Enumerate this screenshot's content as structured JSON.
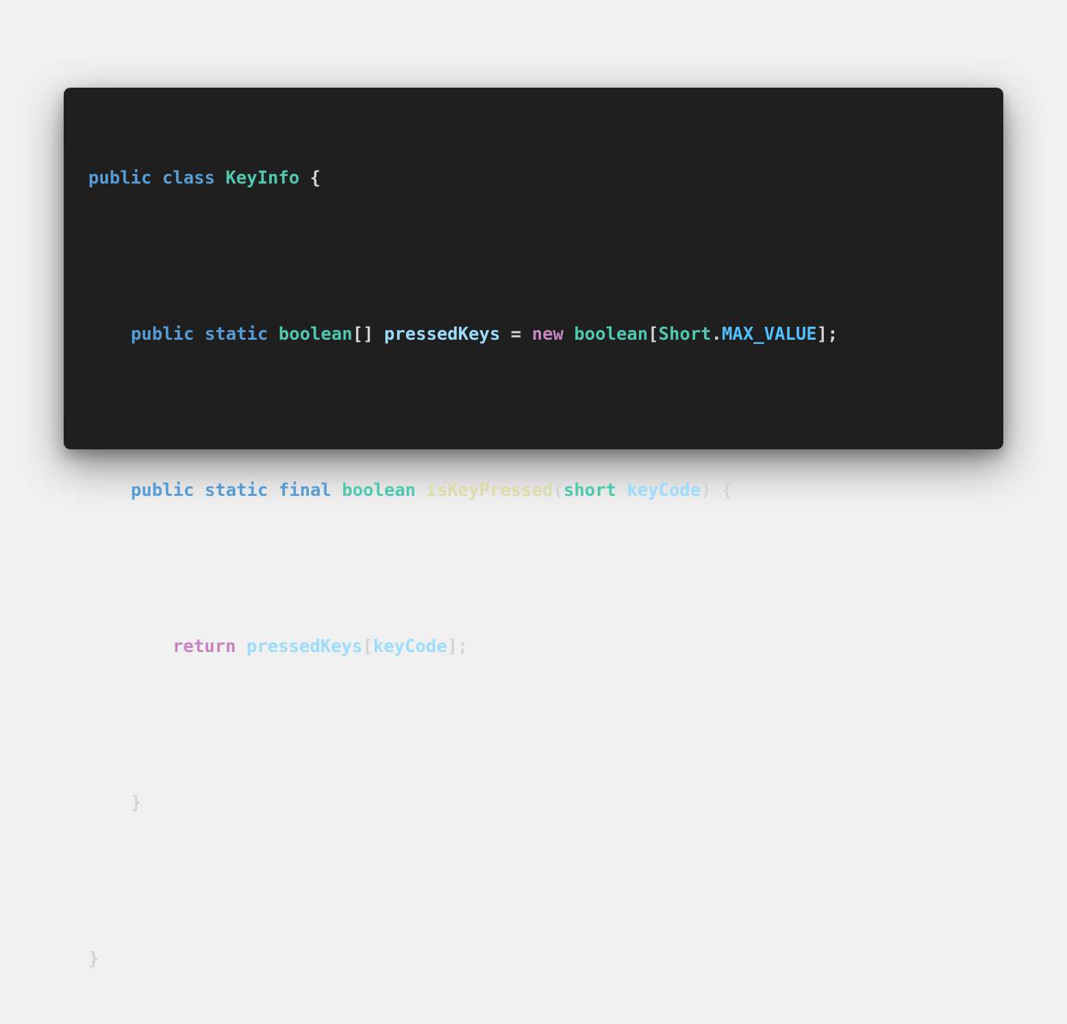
{
  "editor": {
    "language": "java",
    "theme": {
      "background": "#1f1f1f",
      "page_background": "#f0f0f0",
      "keyword": "#569cd6",
      "type": "#4ec9b0",
      "control": "#c586c0",
      "function": "#dcdcaa",
      "variable": "#9cdcfe",
      "constant": "#4fc1ff",
      "punctuation": "#d4d4d4"
    },
    "lines": [
      {
        "tokens": [
          {
            "text": "public",
            "kind": "kw"
          },
          {
            "text": " ",
            "kind": "punc"
          },
          {
            "text": "class",
            "kind": "kw"
          },
          {
            "text": " ",
            "kind": "punc"
          },
          {
            "text": "KeyInfo",
            "kind": "type"
          },
          {
            "text": " {",
            "kind": "punc"
          }
        ]
      },
      {
        "tokens": []
      },
      {
        "tokens": [
          {
            "text": "public",
            "kind": "kw"
          },
          {
            "text": " ",
            "kind": "punc"
          },
          {
            "text": "static",
            "kind": "kw"
          },
          {
            "text": " ",
            "kind": "punc"
          },
          {
            "text": "boolean",
            "kind": "type"
          },
          {
            "text": "[] ",
            "kind": "punc"
          },
          {
            "text": "pressedKeys",
            "kind": "var"
          },
          {
            "text": " = ",
            "kind": "punc"
          },
          {
            "text": "new",
            "kind": "ctrl"
          },
          {
            "text": " ",
            "kind": "punc"
          },
          {
            "text": "boolean",
            "kind": "type"
          },
          {
            "text": "[",
            "kind": "punc"
          },
          {
            "text": "Short",
            "kind": "type"
          },
          {
            "text": ".",
            "kind": "punc"
          },
          {
            "text": "MAX_VALUE",
            "kind": "const"
          },
          {
            "text": "];",
            "kind": "punc"
          }
        ]
      },
      {
        "tokens": []
      },
      {
        "tokens": [
          {
            "text": "public",
            "kind": "kw"
          },
          {
            "text": " ",
            "kind": "punc"
          },
          {
            "text": "static",
            "kind": "kw"
          },
          {
            "text": " ",
            "kind": "punc"
          },
          {
            "text": "final",
            "kind": "kw"
          },
          {
            "text": " ",
            "kind": "punc"
          },
          {
            "text": "boolean",
            "kind": "type"
          },
          {
            "text": " ",
            "kind": "punc"
          },
          {
            "text": "isKeyPressed",
            "kind": "fn"
          },
          {
            "text": "(",
            "kind": "punc"
          },
          {
            "text": "short",
            "kind": "type"
          },
          {
            "text": " ",
            "kind": "punc"
          },
          {
            "text": "keyCode",
            "kind": "var"
          },
          {
            "text": ") {",
            "kind": "punc"
          }
        ]
      },
      {
        "tokens": []
      },
      {
        "tokens": [
          {
            "text": "return",
            "kind": "ctrl"
          },
          {
            "text": " ",
            "kind": "punc"
          },
          {
            "text": "pressedKeys",
            "kind": "var"
          },
          {
            "text": "[",
            "kind": "punc"
          },
          {
            "text": "keyCode",
            "kind": "var"
          },
          {
            "text": "];",
            "kind": "punc"
          }
        ]
      },
      {
        "tokens": []
      },
      {
        "tokens": [
          {
            "text": "}",
            "kind": "punc"
          }
        ]
      },
      {
        "tokens": []
      },
      {
        "tokens": [
          {
            "text": "}",
            "kind": "punc"
          }
        ]
      }
    ]
  }
}
